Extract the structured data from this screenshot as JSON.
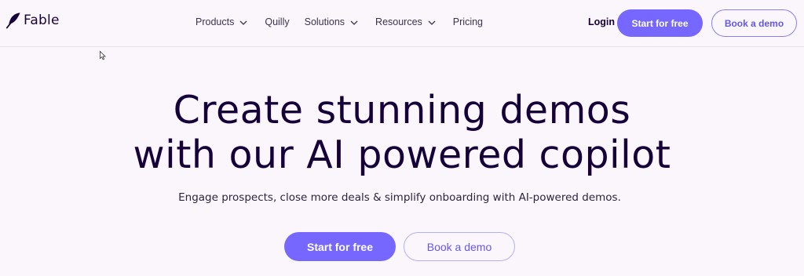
{
  "header": {
    "logo": {
      "text": "Fable",
      "icon": "feather-icon"
    },
    "nav": [
      {
        "label": "Products",
        "dropdown": true
      },
      {
        "label": "Quilly",
        "dropdown": false
      },
      {
        "label": "Solutions",
        "dropdown": true
      },
      {
        "label": "Resources",
        "dropdown": true
      },
      {
        "label": "Pricing",
        "dropdown": false
      }
    ],
    "login_label": "Login",
    "start_label": "Start for free",
    "demo_label": "Book a demo"
  },
  "hero": {
    "title_line1": "Create stunning demos",
    "title_line2": "with our AI powered copilot",
    "subtitle": "Engage prospects, close more deals & simplify onboarding with AI-powered demos.",
    "start_label": "Start for free",
    "demo_label": "Book a demo"
  },
  "colors": {
    "background": "#fbf6fc",
    "accent": "#7567ff",
    "text_dark": "#16003a"
  }
}
